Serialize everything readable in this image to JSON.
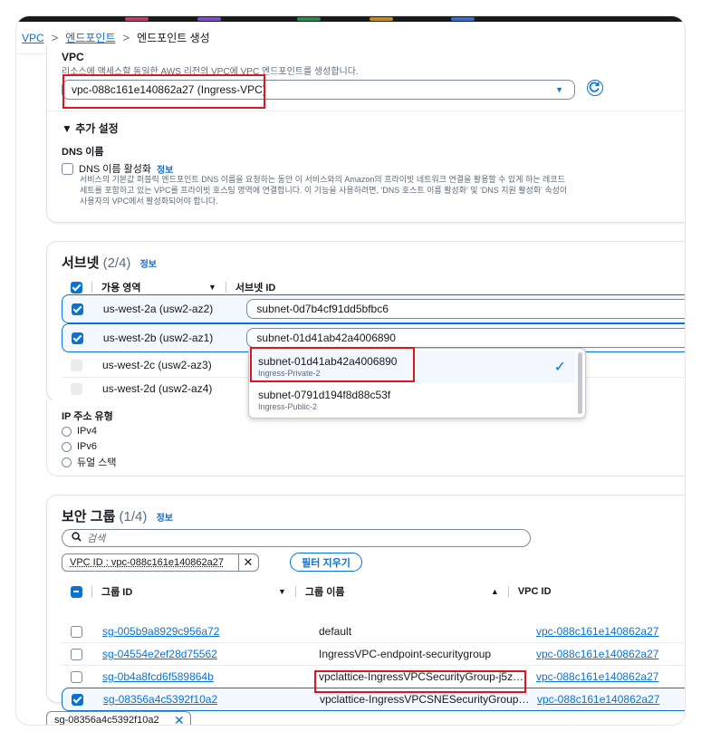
{
  "breadcrumb": {
    "items": [
      "VPC",
      "엔드포인트",
      "엔드포인트 생성"
    ],
    "separator": ">"
  },
  "vpc_section": {
    "title": "VPC",
    "description": "리소스에 액세스할 동일한 AWS 리전의 VPC에 VPC 엔드포인트를 생성합니다.",
    "selected_vpc": "vpc-088c161e140862a27 (Ingress-VPC)",
    "additional_settings": "▼ 추가 설정",
    "dns_title": "DNS 이름",
    "dns_checkbox_label": "DNS 이름 활성화",
    "dns_info": "정보",
    "dns_description_1": "서비스의 기본값 퍼블릭 엔드포인트 DNS 이름을 요청하는 동안 이 서비스와의 Amazon의 프라이빗 네트워크 연결을 활용할 수 있게 하는 레코드",
    "dns_description_2": "세트를 포함하고 있는 VPC를 프라이빗 호스팅 영역에 연결합니다. 이 기능을 사용하려면, 'DNS 호스트 이름 활성화' 및 'DNS 지원 활성화' 속성이",
    "dns_description_3": "사용자의 VPC에서 활성화되어야 합니다."
  },
  "subnets": {
    "title": "서브넷",
    "count": "(2/4)",
    "info": "정보",
    "col_az": "가용 영역",
    "col_subnet": "서브넷 ID",
    "rows": [
      {
        "az": "us-west-2a (usw2-az2)",
        "subnet": "subnet-0d7b4cf91dd5bfbc6"
      },
      {
        "az": "us-west-2b (usw2-az1)",
        "subnet": "subnet-01d41ab42a4006890"
      },
      {
        "az": "us-west-2c (usw2-az3)",
        "subnet": ""
      },
      {
        "az": "us-west-2d (usw2-az4)",
        "subnet": ""
      }
    ],
    "dropdown": [
      {
        "id": "subnet-01d41ab42a4006890",
        "name": "Ingress-Private-2"
      },
      {
        "id": "subnet-0791d194f8d88c53f",
        "name": "Ingress-Public-2"
      }
    ]
  },
  "ip_type": {
    "title": "IP 주소 유형",
    "options": [
      "IPv4",
      "IPv6",
      "듀얼 스택"
    ]
  },
  "security_groups": {
    "title": "보안 그룹",
    "count": "(1/4)",
    "info": "정보",
    "search_placeholder": "검색",
    "filter_token": "VPC ID : vpc-088c161e140862a27",
    "clear_filter": "필터 지우기",
    "col_id": "그룹 ID",
    "col_name": "그룹 이름",
    "col_vpc": "VPC ID",
    "rows": [
      {
        "id": "sg-005b9a8929c956a72",
        "name": "default",
        "vpc": "vpc-088c161e140862a27"
      },
      {
        "id": "sg-04554e2ef28d75562",
        "name": "IngressVPC-endpoint-securitygroup",
        "vpc": "vpc-088c161e140862a27"
      },
      {
        "id": "sg-0b4a8fcd6f589864b",
        "name": "vpclattice-IngressVPCSecurityGroup-j5z…",
        "vpc": "vpc-088c161e140862a27"
      },
      {
        "id": "sg-08356a4c5392f10a2",
        "name": "vpclattice-IngressVPCSNESecurityGroup…",
        "vpc": "vpc-088c161e140862a27"
      }
    ],
    "selected_token": "sg-08356a4c5392f10a2"
  },
  "colors": {
    "accent": "#0972d3",
    "highlight": "#e0141e",
    "text": "#16191f",
    "muted": "#5f6b7a"
  }
}
